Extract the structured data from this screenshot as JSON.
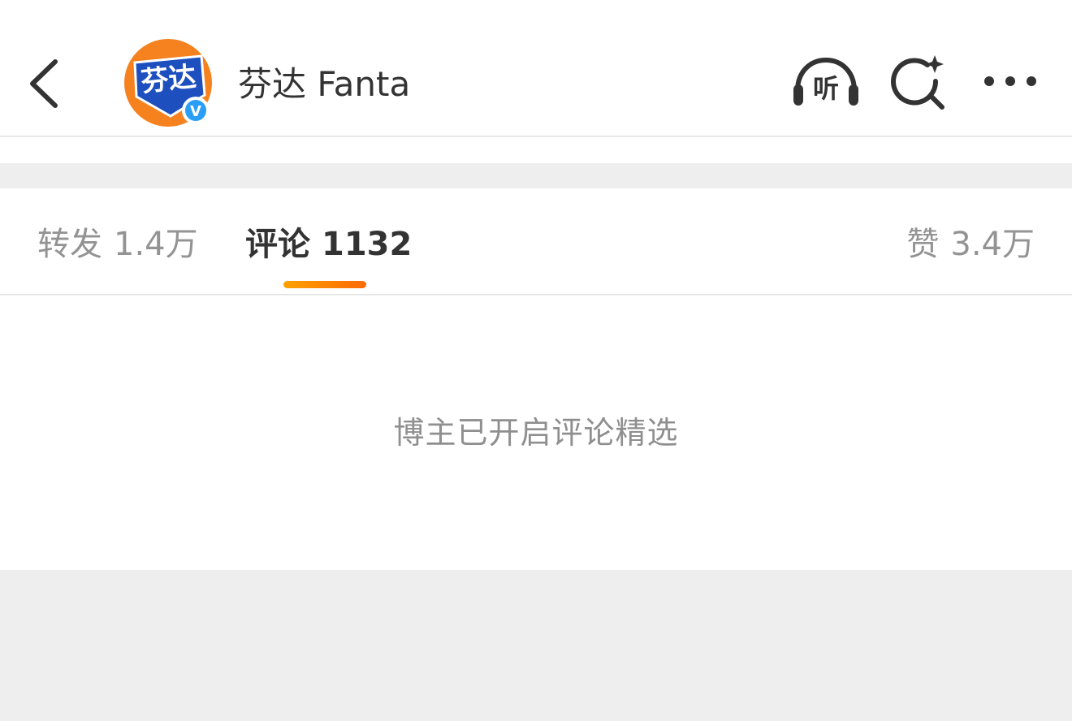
{
  "header": {
    "account_name": "芬达 Fanta",
    "avatar_logo_text": "芬达",
    "verified_badge": "V",
    "listen_label": "听",
    "icons": {
      "back": "chevron-left-icon",
      "listen": "headphones-icon",
      "search": "search-sparkle-icon",
      "more": "more-dots-icon"
    },
    "brand_colors": {
      "avatar_orange": "#f5821f",
      "avatar_blue": "#1d4fbf",
      "badge_blue": "#2a9df4"
    }
  },
  "tabs": [
    {
      "label": "转发",
      "count": "1.4万",
      "active": false
    },
    {
      "label": "评论",
      "count": "1132",
      "active": true
    },
    {
      "label": "赞",
      "count": "3.4万",
      "active": false
    }
  ],
  "accent_color": "#ff8200",
  "content": {
    "notice": "博主已开启评论精选"
  }
}
